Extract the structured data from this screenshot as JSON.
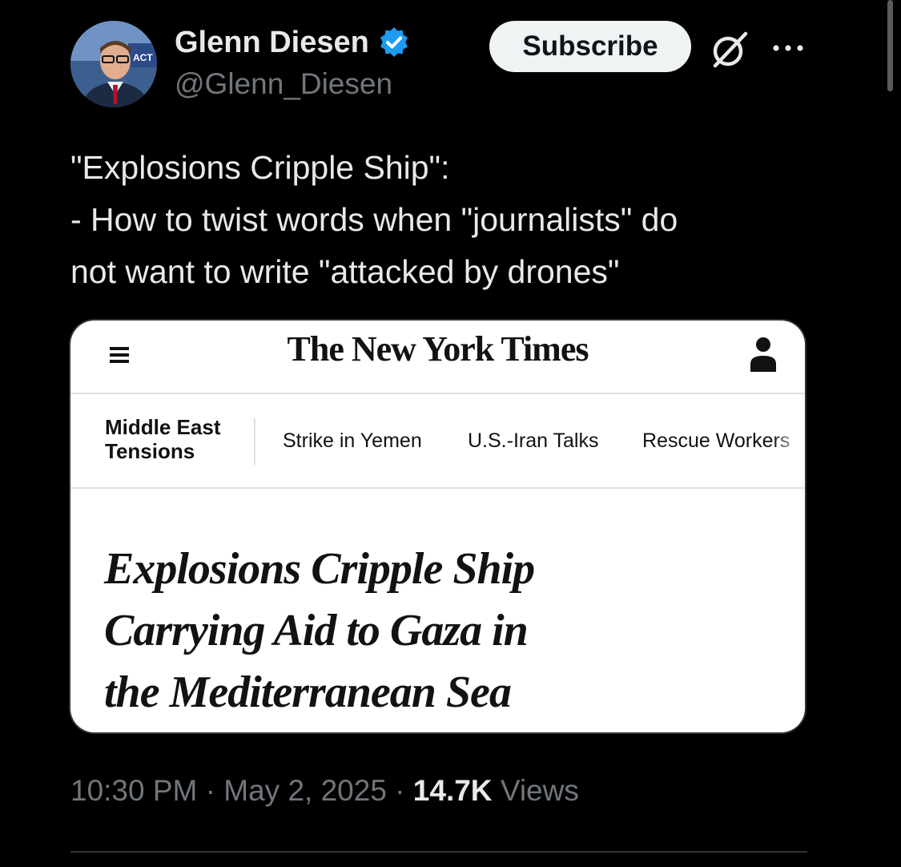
{
  "author": {
    "display_name": "Glenn Diesen",
    "handle": "@Glenn_Diesen",
    "verified_color": "#1d9bf0"
  },
  "actions": {
    "subscribe_label": "Subscribe",
    "grok_icon": "grok-icon",
    "more_icon": "more-dots-icon"
  },
  "tweet": {
    "lines": [
      "\"Explosions Cripple Ship\":",
      "- How to twist words when \"journalists\" do",
      "not want to write \"attacked by drones\""
    ]
  },
  "media": {
    "logo": "The New York Times",
    "section_label_lines": [
      "Middle East",
      "Tensions"
    ],
    "subnav_links": [
      "Strike in Yemen",
      "U.S.-Iran Talks",
      "Rescue Workers"
    ],
    "headline_lines": [
      "Explosions Cripple Ship",
      "Carrying Aid to Gaza in",
      "the Mediterranean Sea"
    ]
  },
  "meta": {
    "time": "10:30 PM",
    "separator": " · ",
    "date": "May 2, 2025",
    "views_count": "14.7K",
    "views_label": "Views"
  },
  "colors": {
    "background": "#000000",
    "text_primary": "#e7e9ea",
    "text_secondary": "#71767b",
    "accent_blue": "#1d9bf0",
    "divider": "#2f3336"
  }
}
